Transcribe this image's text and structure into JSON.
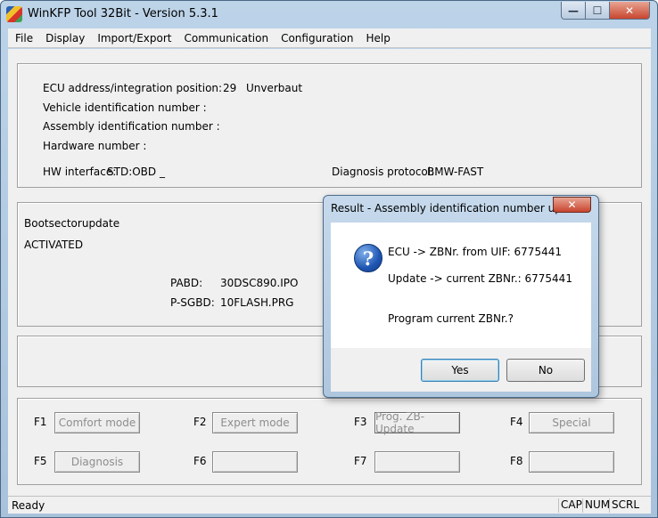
{
  "window": {
    "title": "WinKFP Tool 32Bit - Version 5.3.1",
    "min_glyph": "—",
    "max_glyph": "☐",
    "close_glyph": "✕"
  },
  "menu": [
    "File",
    "Display",
    "Import/Export",
    "Communication",
    "Configuration",
    "Help"
  ],
  "info": {
    "ecu_label": "ECU address/integration position:",
    "ecu_value": "29",
    "ecu_status": "Unverbaut",
    "vin_label": "Vehicle identification number :",
    "assembly_label": "Assembly identification number :",
    "hardware_label": "Hardware number :",
    "hw_interface_label": "HW interface:",
    "hw_interface_value": "STD:OBD _",
    "diag_protocol_label": "Diagnosis protocol:",
    "diag_protocol_value": "BMW-FAST"
  },
  "boot": {
    "title": "Bootsectorupdate",
    "status": "ACTIVATED",
    "pabd_label": "PABD:",
    "pabd_value": "30DSC890.IPO",
    "psgbd_label": "P-SGBD:",
    "psgbd_value": "10FLASH.PRG"
  },
  "fkeys": [
    {
      "key": "F1",
      "label": "Comfort mode"
    },
    {
      "key": "F2",
      "label": "Expert mode"
    },
    {
      "key": "F3",
      "label": "Prog. ZB-Update"
    },
    {
      "key": "F4",
      "label": "Special"
    },
    {
      "key": "F5",
      "label": "Diagnosis"
    },
    {
      "key": "F6",
      "label": ""
    },
    {
      "key": "F7",
      "label": ""
    },
    {
      "key": "F8",
      "label": ""
    }
  ],
  "status": {
    "text": "Ready",
    "cap": "CAP",
    "num": "NUM",
    "scrl": "SCRL"
  },
  "dialog": {
    "title": "Result - Assembly identification number upd...",
    "close_glyph": "✕",
    "icon_glyph": "?",
    "line1": "ECU -> ZBNr. from UIF: 6775441",
    "line2": "Update -> current ZBNr.: 6775441",
    "line3": "Program current ZBNr.?",
    "yes_label": "Yes",
    "no_label": "No"
  }
}
